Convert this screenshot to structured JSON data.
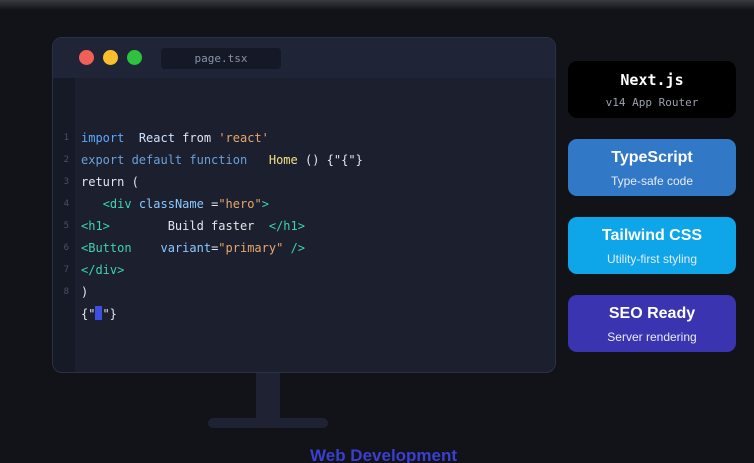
{
  "editor": {
    "tab_title": "page.tsx",
    "line_numbers": [
      "1",
      "2",
      "3",
      "4",
      "5",
      "6",
      "7",
      "8"
    ],
    "lines": {
      "l1": {
        "a": "import",
        "b": "React",
        "c": "from",
        "d": "'react'"
      },
      "l2": {
        "a": "export default function",
        "b": "Home",
        "c": "() {\"{\"}"
      },
      "l3": {
        "a": "return ("
      },
      "l4": {
        "a": "<div",
        "b": "className",
        "c": "=",
        "d": "\"hero\"",
        "e": ">"
      },
      "l5": {
        "a": "<h1>",
        "b": "Build faster",
        "c": "</h1>"
      },
      "l6": {
        "a": "<Button",
        "b": "variant",
        "c": "=",
        "d": "\"primary\"",
        "e": "/>"
      },
      "l7": {
        "a": "</div>"
      },
      "l8": {
        "a": ")"
      },
      "l9": {
        "a": "{\"",
        "b": "}",
        "c": "\"}"
      }
    }
  },
  "cards": [
    {
      "title": "Next.js",
      "subtitle": "v14 App Router"
    },
    {
      "title": "TypeScript",
      "subtitle": "Type-safe code"
    },
    {
      "title": "Tailwind CSS",
      "subtitle": "Utility-first styling"
    },
    {
      "title": "SEO Ready",
      "subtitle": "Server rendering"
    }
  ],
  "footer": {
    "title": "Web Development"
  },
  "colors": {
    "background": "#121318",
    "editor_bg": "#1b1f2e",
    "nextjs": "#000000",
    "typescript": "#3178c6",
    "tailwind": "#0ea5e9",
    "seo": "#3b34b0",
    "footer_text": "#3a3fd1"
  }
}
